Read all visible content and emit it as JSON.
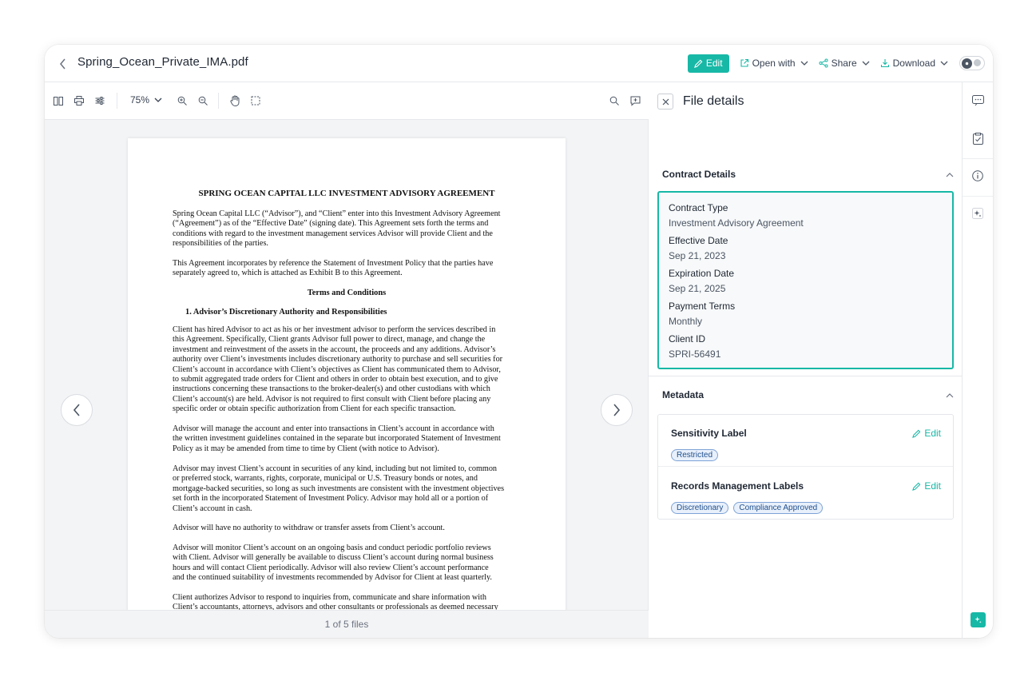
{
  "header": {
    "file_name": "Spring_Ocean_Private_IMA.pdf",
    "edit_label": "Edit",
    "open_with_label": "Open with",
    "share_label": "Share",
    "download_label": "Download"
  },
  "viewer": {
    "zoom": "75%",
    "footer": "1 of 5 files",
    "document": {
      "title": "SPRING OCEAN CAPITAL LLC INVESTMENT ADVISORY AGREEMENT",
      "p1": "Spring Ocean Capital LLC (“Advisor”), and “Client” enter into this Investment Advisory Agreement\n(“Agreement”) as of the “Effective Date” (signing date). This Agreement sets forth the terms and\nconditions with regard to the investment management services Advisor will provide Client and the\nresponsibilities of the parties.",
      "p2": "This Agreement incorporates by reference the Statement of Investment Policy that the parties have\nseparately agreed to, which is attached as Exhibit B to this Agreement.",
      "h_terms": "Terms and Conditions",
      "h_section1": "1.   Advisor’s Discretionary Authority and Responsibilities",
      "p3": "Client has hired Advisor to act as his or her investment advisor to perform the services described in\nthis Agreement.   Specifically, Client grants Advisor full power to direct, manage, and change the\ninvestment and reinvestment of the assets in the account, the proceeds and any additions.  Advisor’s\nauthority over Client’s investments includes discretionary authority to purchase and sell securities for\nClient’s account in accordance with Client’s objectives as Client has communicated them to Advisor,\nto submit aggregated trade orders for Client and others in order to obtain best execution, and to give\ninstructions concerning these transactions to the broker-dealer(s) and other custodians with which\nClient’s account(s) are held.  Advisor is not required to first consult with Client before placing any\nspecific order or obtain specific authorization from Client for each specific transaction.",
      "p4": "Advisor will manage the account and enter into transactions in Client’s account in accordance with\nthe written investment guidelines contained in the separate but incorporated Statement of Investment\nPolicy as it may be amended from time to time by Client (with notice to Advisor).",
      "p5": "Advisor may invest Client’s account in securities of any kind, including but not limited to, common\nor preferred stock, warrants, rights, corporate, municipal or U.S. Treasury bonds or notes, and\nmortgage-backed securities, so long as such investments are consistent with the investment objectives\nset forth in the incorporated Statement of Investment Policy.  Advisor may hold all or a portion of\nClient’s account in cash.",
      "p6": "Advisor will have no authority to withdraw or transfer assets from Client’s account.",
      "p7": "Advisor will monitor Client’s account on an ongoing basis and conduct periodic portfolio reviews\nwith Client.  Advisor will generally be available to discuss Client’s account during normal business\nhours and will contact Client periodically.  Advisor will also review Client’s account performance\nand the continued suitability of investments recommended by Advisor for Client at least quarterly.",
      "p8": "Client authorizes Advisor to respond to inquiries from, communicate and share information with\nClient’s accountants, attorneys, advisors and other consultants or professionals as deemed necessary"
    }
  },
  "panel": {
    "title": "File details",
    "contract_section": "Contract Details",
    "fields": [
      {
        "label": "Contract Type",
        "value": "Investment Advisory Agreement"
      },
      {
        "label": "Effective Date",
        "value": "Sep 21, 2023"
      },
      {
        "label": "Expiration Date",
        "value": "Sep 21, 2025"
      },
      {
        "label": "Payment Terms",
        "value": "Monthly"
      },
      {
        "label": "Client ID",
        "value": "SPRI-56491"
      }
    ],
    "metadata_section": "Metadata",
    "sensitivity": {
      "label": "Sensitivity Label",
      "edit": "Edit",
      "chips": [
        "Restricted"
      ]
    },
    "records": {
      "label": "Records Management Labels",
      "edit": "Edit",
      "chips": [
        "Discretionary",
        "Compliance Approved"
      ]
    }
  },
  "colors": {
    "accent": "#17b8a6",
    "chip_text": "#1f4e8c",
    "chip_border": "#7ea3d6"
  }
}
